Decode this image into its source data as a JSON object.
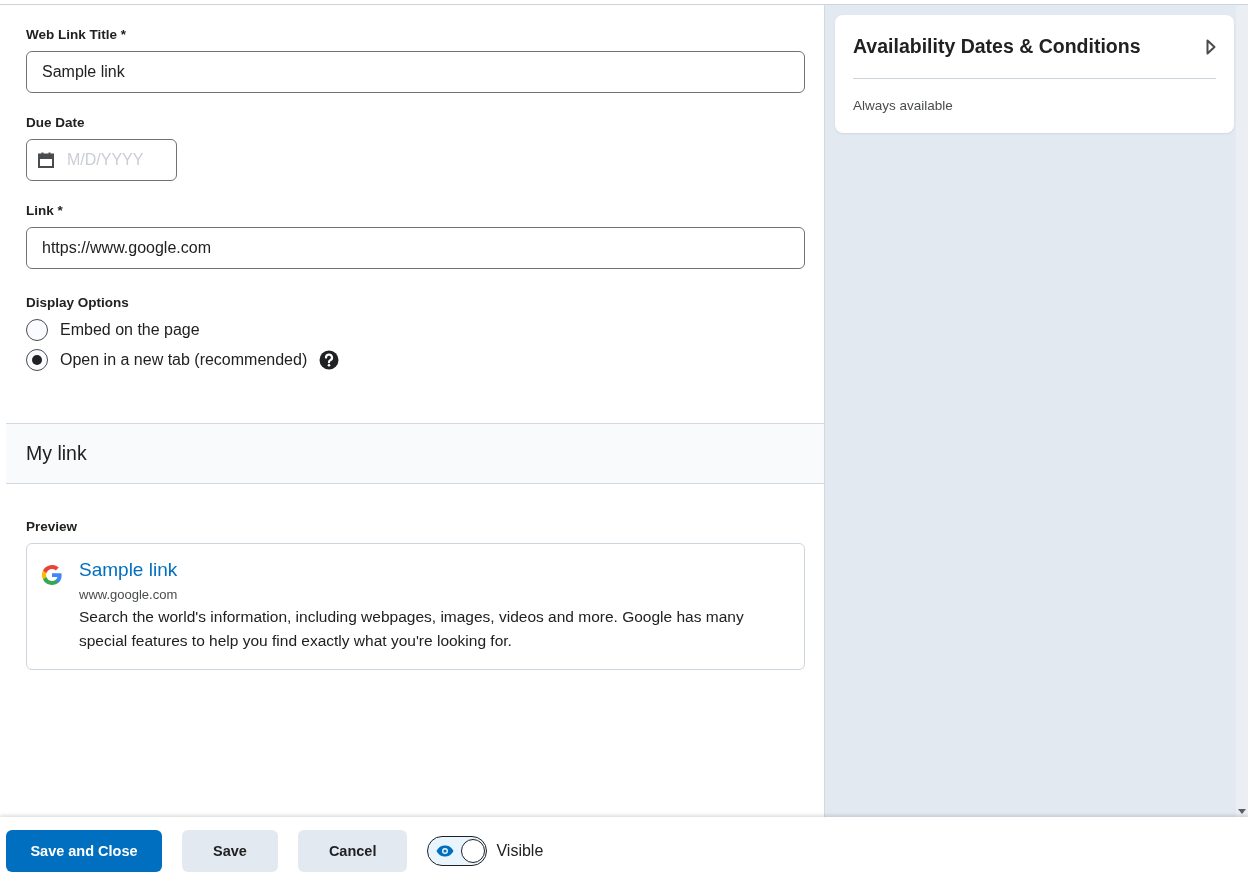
{
  "form": {
    "title_field": {
      "label": "Web Link Title *",
      "value": "Sample link"
    },
    "due_date": {
      "label": "Due Date",
      "placeholder": "M/D/YYYY"
    },
    "link_field": {
      "label": "Link *",
      "value": "https://www.google.com"
    },
    "display_options": {
      "label": "Display Options",
      "options": [
        {
          "label": "Embed on the page",
          "selected": false,
          "help": false
        },
        {
          "label": "Open in a new tab (recommended)",
          "selected": true,
          "help": true
        }
      ]
    }
  },
  "section": {
    "heading": "My link"
  },
  "preview": {
    "label": "Preview",
    "title": "Sample link",
    "url": "www.google.com",
    "description": "Search the world's information, including webpages, images, videos and more. Google has many special features to help you find exactly what you're looking for."
  },
  "side_panel": {
    "title": "Availability Dates & Conditions",
    "status": "Always available"
  },
  "footer": {
    "buttons": [
      {
        "label": "Save and Close",
        "kind": "primary"
      },
      {
        "label": "Save",
        "kind": "secondary"
      },
      {
        "label": "Cancel",
        "kind": "secondary"
      }
    ],
    "visibility": {
      "label": "Visible",
      "on": true
    }
  }
}
